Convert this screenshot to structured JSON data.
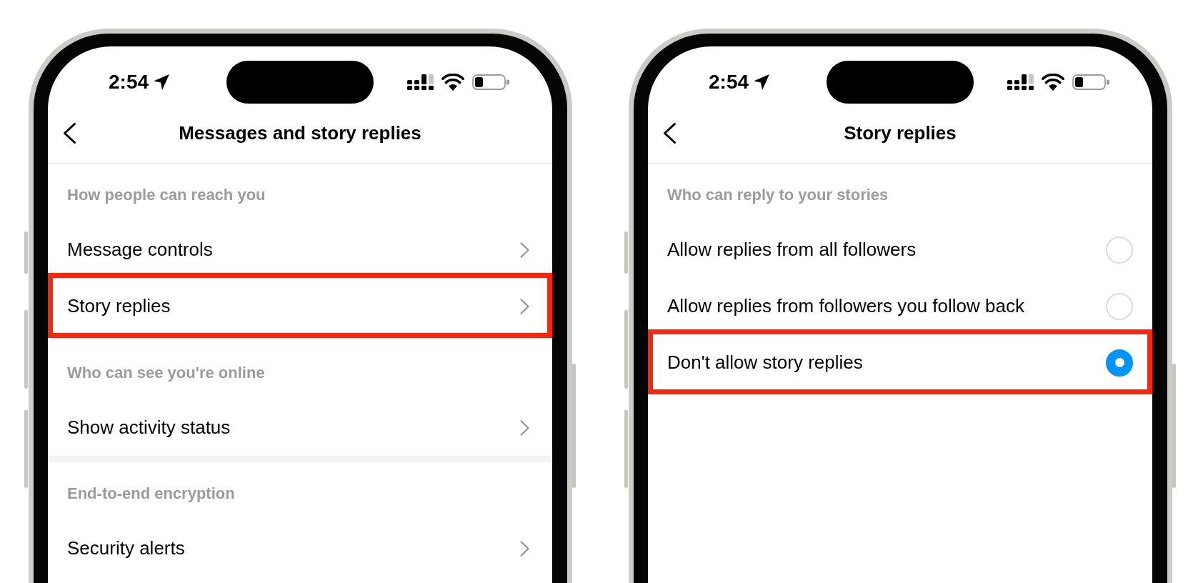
{
  "phones": [
    {
      "status_bar": {
        "time": "2:54"
      },
      "header": {
        "title": "Messages and story replies"
      },
      "groups": [
        {
          "sections": [
            {
              "label": "How people can reach you",
              "rows": [
                {
                  "kind": "link",
                  "label": "Message controls",
                  "highlighted": false
                },
                {
                  "kind": "link",
                  "label": "Story replies",
                  "highlighted": true
                }
              ]
            },
            {
              "label": "Who can see you're online",
              "rows": [
                {
                  "kind": "link",
                  "label": "Show activity status",
                  "highlighted": false
                }
              ]
            }
          ]
        },
        {
          "sections": [
            {
              "label": "End-to-end encryption",
              "rows": [
                {
                  "kind": "link",
                  "label": "Security alerts",
                  "highlighted": false
                }
              ]
            }
          ]
        }
      ]
    },
    {
      "status_bar": {
        "time": "2:54"
      },
      "header": {
        "title": "Story replies"
      },
      "groups": [
        {
          "sections": [
            {
              "label": "Who can reply to your stories",
              "rows": [
                {
                  "kind": "radio",
                  "label": "Allow replies from all followers",
                  "selected": false,
                  "highlighted": false
                },
                {
                  "kind": "radio",
                  "label": "Allow replies from followers you follow back",
                  "selected": false,
                  "highlighted": false
                },
                {
                  "kind": "radio",
                  "label": "Don't allow story replies",
                  "selected": true,
                  "highlighted": true
                }
              ]
            }
          ]
        }
      ]
    }
  ]
}
